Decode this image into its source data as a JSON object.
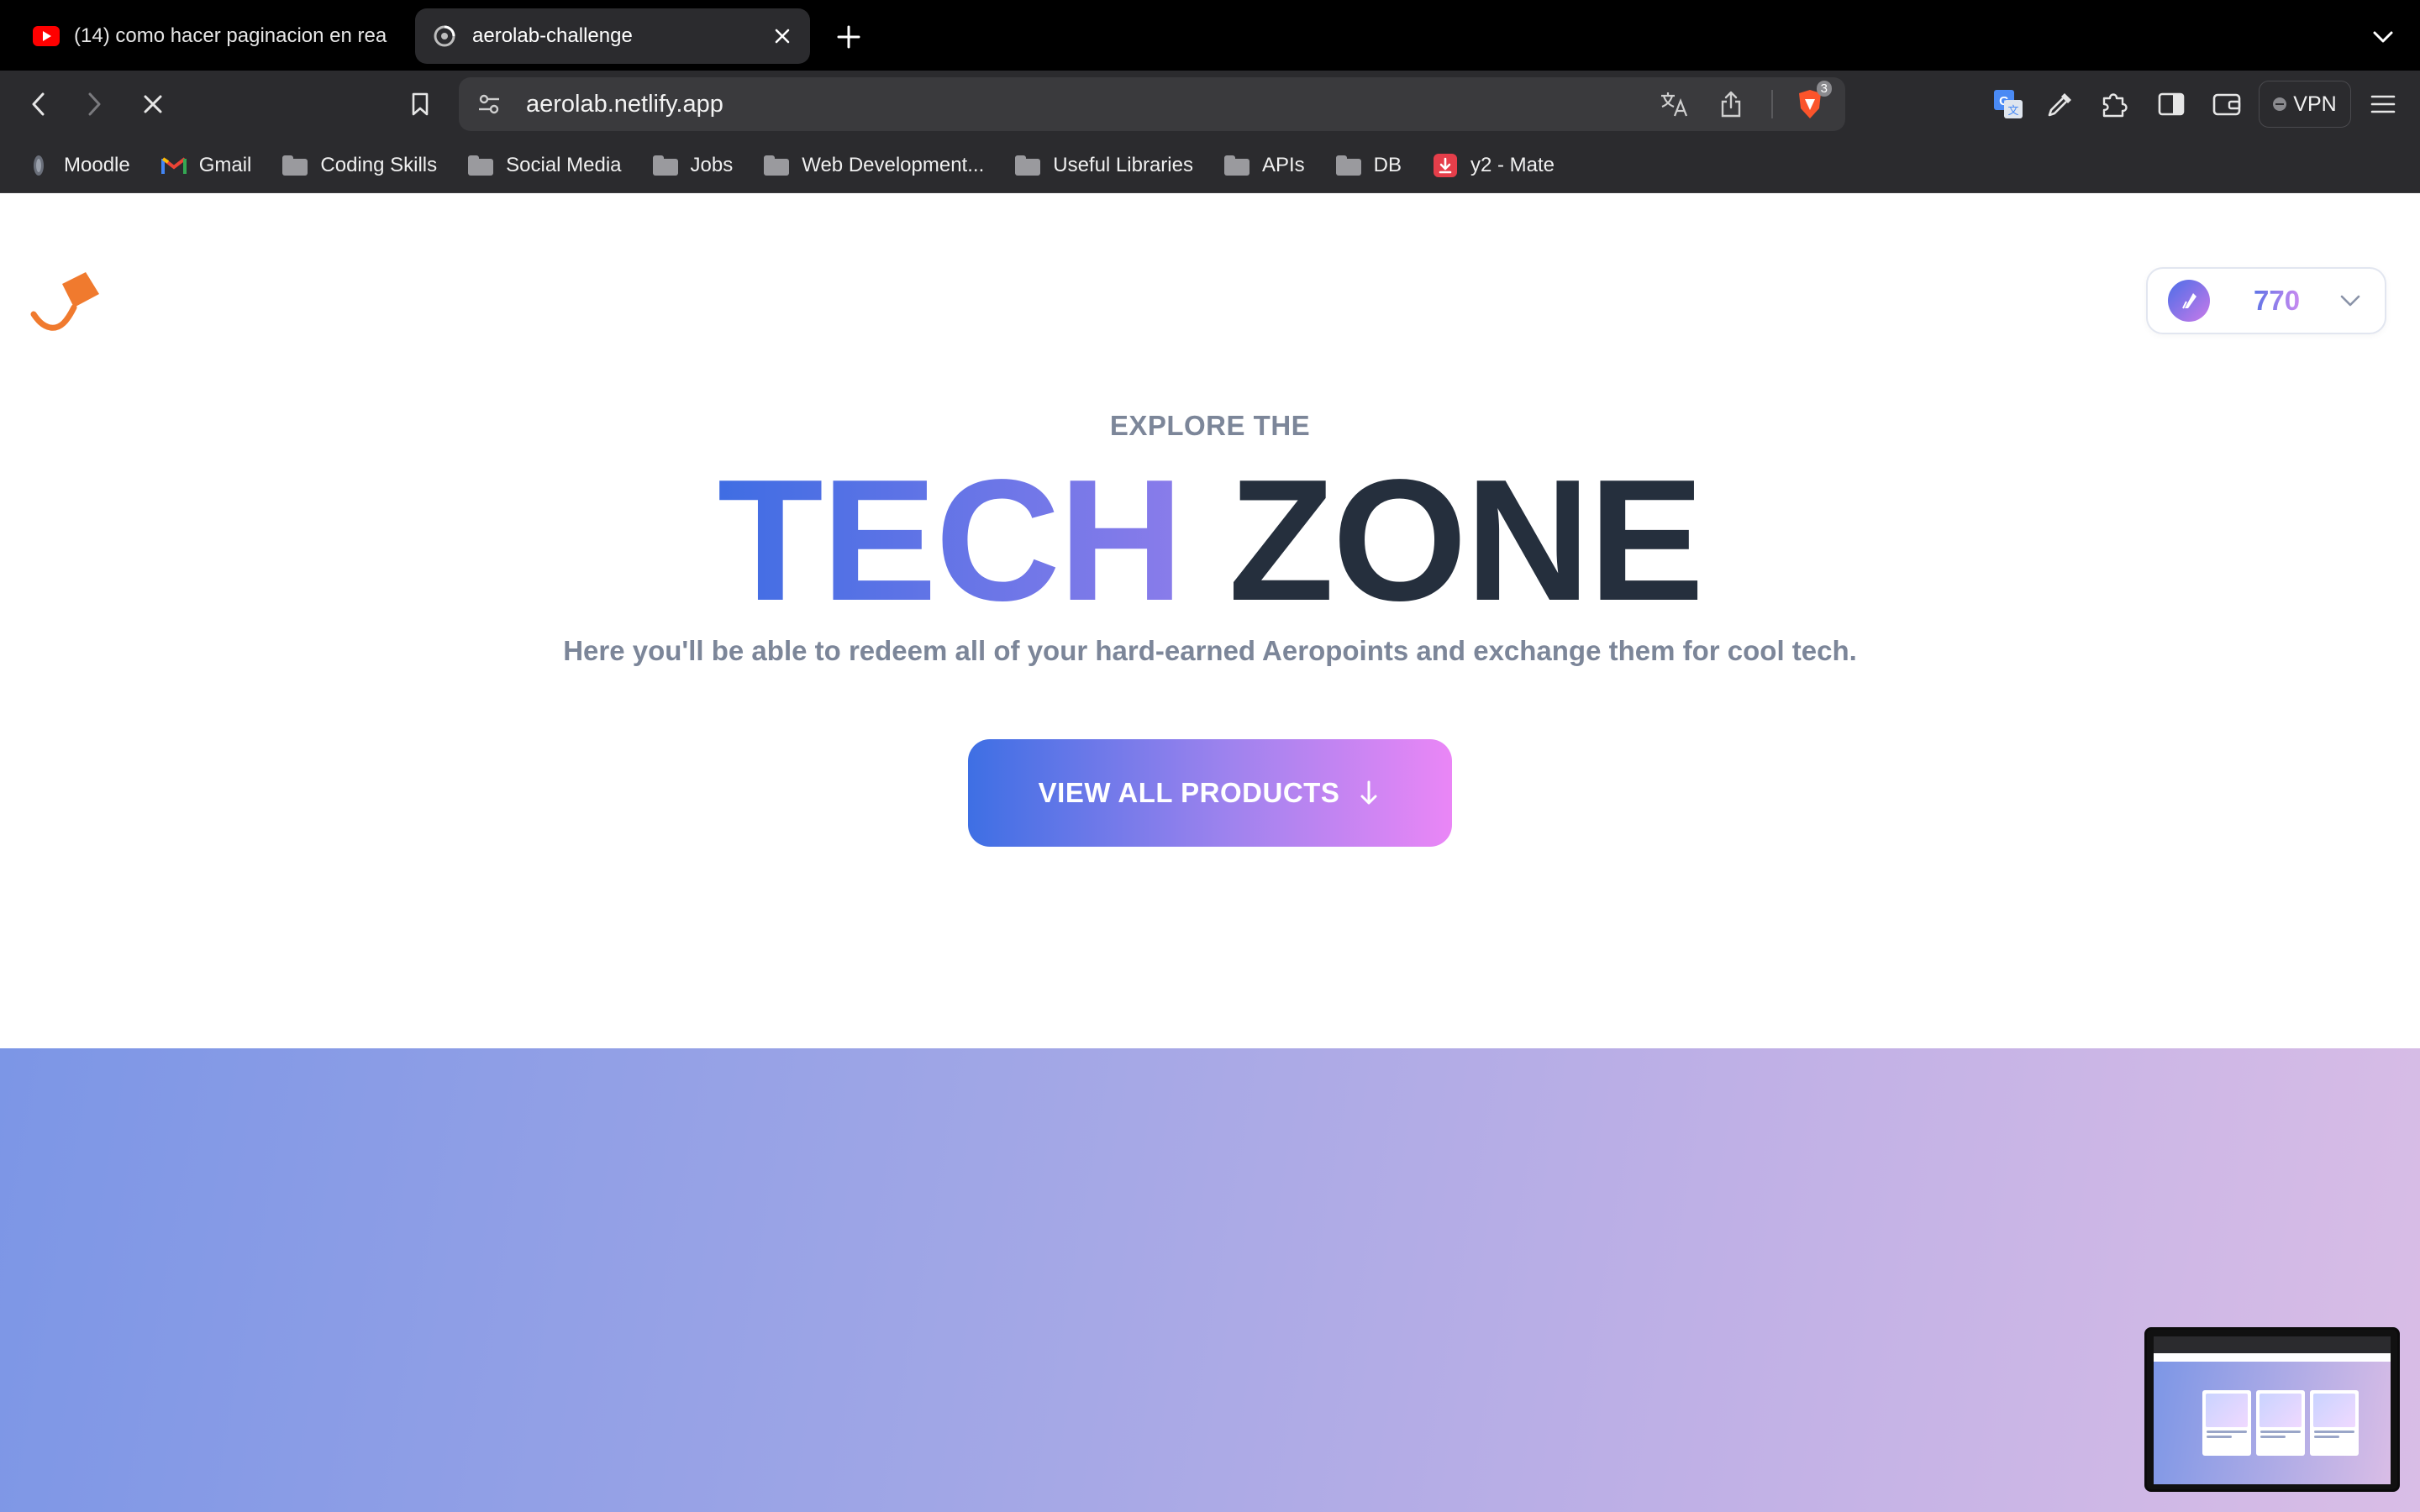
{
  "browser": {
    "tabs": [
      {
        "title": "(14) como hacer paginacion en rea",
        "favicon": "youtube-icon",
        "active": false
      },
      {
        "title": "aerolab-challenge",
        "favicon": "loading-spinner-icon",
        "active": true
      }
    ],
    "url": "aerolab.netlify.app",
    "shield_count": "3",
    "vpn_label": "VPN",
    "bookmarks": [
      {
        "label": "Moodle",
        "icon": "moodle-icon"
      },
      {
        "label": "Gmail",
        "icon": "gmail-icon"
      },
      {
        "label": "Coding Skills",
        "icon": "folder-icon"
      },
      {
        "label": "Social Media",
        "icon": "folder-icon"
      },
      {
        "label": "Jobs",
        "icon": "folder-icon"
      },
      {
        "label": "Web Development...",
        "icon": "folder-icon"
      },
      {
        "label": "Useful Libraries",
        "icon": "folder-icon"
      },
      {
        "label": "APIs",
        "icon": "folder-icon"
      },
      {
        "label": "DB",
        "icon": "folder-icon"
      },
      {
        "label": "y2 - Mate",
        "icon": "download-icon"
      }
    ]
  },
  "page": {
    "points": "770",
    "hero": {
      "eyebrow": "EXPLORE THE",
      "title_gradient": "TECH",
      "title_dark": "ZONE",
      "subtitle": "Here you'll be able to redeem all of your hard-earned Aeropoints and exchange them for cool tech.",
      "cta_label": "VIEW ALL PRODUCTS"
    }
  },
  "colors": {
    "brand_blue": "#3f6de3",
    "brand_pink": "#ea86f6",
    "title_dark": "#252f3d",
    "muted_text": "#7c8699",
    "logo_orange": "#f07a2e"
  }
}
